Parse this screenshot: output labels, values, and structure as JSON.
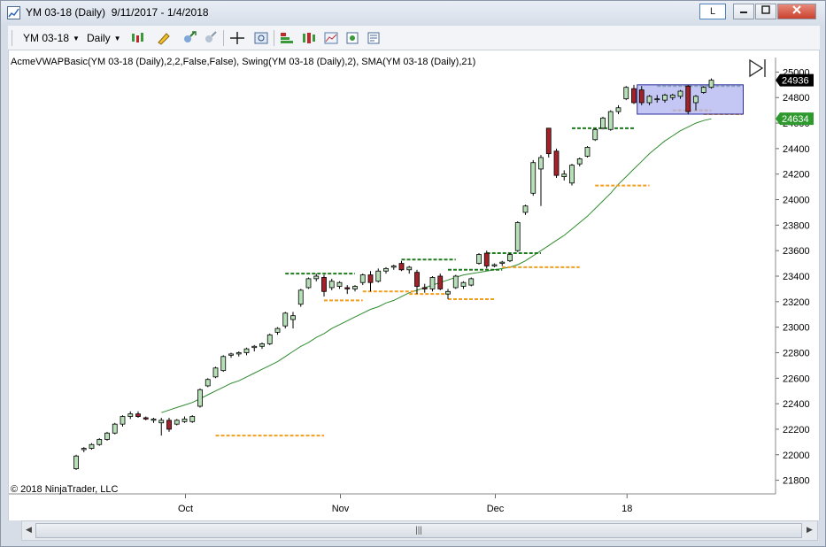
{
  "window": {
    "title": "YM 03-18 (Daily)  9/11/2017 - 1/4/2018",
    "link_button_label": "L",
    "icons": [
      "chart-window-icon",
      "minimize-icon",
      "maximize-icon",
      "close-icon"
    ]
  },
  "toolbar": {
    "instrument_label": "YM 03-18",
    "interval_label": "Daily",
    "icons": [
      "chart-style-icon",
      "drawing-tools-icon",
      "zoom-in-icon",
      "zoom-out-icon",
      "crosshair-icon",
      "data-box-icon",
      "indicators-icon",
      "strategies-icon",
      "templates-icon",
      "snapshot-icon",
      "properties-icon"
    ]
  },
  "chart": {
    "indicator_label": "AcmeVWAPBasic(YM 03-18 (Daily),2,2,False,False), Swing(YM 03-18 (Daily),2), SMA(YM 03-18 (Daily),21)",
    "copyright": "© 2018 NinjaTrader, LLC",
    "last_price_label": "24936",
    "sma_price_label": "24634",
    "colors": {
      "up_candle": "#b8e0b8",
      "down_candle": "#a3222a",
      "swing_high": "#1f7a1f",
      "swing_low": "#f0a020",
      "sma": "#2e8b2e",
      "price_badge": "#000000",
      "sma_badge": "#2e9a2e",
      "range_box": "#b0b3f0"
    }
  },
  "chart_data": {
    "type": "candlestick",
    "title": "YM 03-18 (Daily)",
    "x_tick_labels": [
      "Oct",
      "Nov",
      "Dec",
      "18"
    ],
    "y_tick_labels": [
      21800,
      22000,
      22200,
      22400,
      22600,
      22800,
      23000,
      23200,
      23400,
      23600,
      23800,
      24000,
      24200,
      24400,
      24600,
      24800,
      25000
    ],
    "ylim": [
      21700,
      25100
    ],
    "grid": false,
    "candles": [
      {
        "o": 21890,
        "h": 22000,
        "l": 21880,
        "c": 21990
      },
      {
        "o": 22040,
        "h": 22060,
        "l": 22020,
        "c": 22050
      },
      {
        "o": 22050,
        "h": 22090,
        "l": 22040,
        "c": 22080
      },
      {
        "o": 22080,
        "h": 22130,
        "l": 22070,
        "c": 22120
      },
      {
        "o": 22120,
        "h": 22180,
        "l": 22110,
        "c": 22170
      },
      {
        "o": 22170,
        "h": 22250,
        "l": 22160,
        "c": 22240
      },
      {
        "o": 22240,
        "h": 22310,
        "l": 22220,
        "c": 22300
      },
      {
        "o": 22300,
        "h": 22340,
        "l": 22280,
        "c": 22320
      },
      {
        "o": 22320,
        "h": 22340,
        "l": 22290,
        "c": 22300
      },
      {
        "o": 22290,
        "h": 22300,
        "l": 22270,
        "c": 22280
      },
      {
        "o": 22270,
        "h": 22290,
        "l": 22250,
        "c": 22280
      },
      {
        "o": 22250,
        "h": 22290,
        "l": 22150,
        "c": 22270
      },
      {
        "o": 22270,
        "h": 22290,
        "l": 22180,
        "c": 22200
      },
      {
        "o": 22240,
        "h": 22280,
        "l": 22230,
        "c": 22270
      },
      {
        "o": 22260,
        "h": 22300,
        "l": 22250,
        "c": 22280
      },
      {
        "o": 22260,
        "h": 22310,
        "l": 22250,
        "c": 22300
      },
      {
        "o": 22380,
        "h": 22520,
        "l": 22370,
        "c": 22510
      },
      {
        "o": 22540,
        "h": 22600,
        "l": 22530,
        "c": 22590
      },
      {
        "o": 22610,
        "h": 22690,
        "l": 22600,
        "c": 22680
      },
      {
        "o": 22660,
        "h": 22780,
        "l": 22650,
        "c": 22770
      },
      {
        "o": 22780,
        "h": 22800,
        "l": 22760,
        "c": 22790
      },
      {
        "o": 22790,
        "h": 22810,
        "l": 22770,
        "c": 22800
      },
      {
        "o": 22800,
        "h": 22840,
        "l": 22780,
        "c": 22830
      },
      {
        "o": 22840,
        "h": 22860,
        "l": 22810,
        "c": 22850
      },
      {
        "o": 22850,
        "h": 22880,
        "l": 22830,
        "c": 22870
      },
      {
        "o": 22870,
        "h": 22950,
        "l": 22860,
        "c": 22940
      },
      {
        "o": 22960,
        "h": 23000,
        "l": 22940,
        "c": 22990
      },
      {
        "o": 23010,
        "h": 23120,
        "l": 22990,
        "c": 23110
      },
      {
        "o": 23060,
        "h": 23120,
        "l": 22990,
        "c": 23090
      },
      {
        "o": 23180,
        "h": 23300,
        "l": 23160,
        "c": 23290
      },
      {
        "o": 23310,
        "h": 23390,
        "l": 23300,
        "c": 23380
      },
      {
        "o": 23380,
        "h": 23420,
        "l": 23360,
        "c": 23400
      },
      {
        "o": 23390,
        "h": 23410,
        "l": 23240,
        "c": 23280
      },
      {
        "o": 23310,
        "h": 23380,
        "l": 23290,
        "c": 23360
      },
      {
        "o": 23320,
        "h": 23360,
        "l": 23300,
        "c": 23350
      },
      {
        "o": 23310,
        "h": 23330,
        "l": 23260,
        "c": 23300
      },
      {
        "o": 23300,
        "h": 23330,
        "l": 23280,
        "c": 23320
      },
      {
        "o": 23350,
        "h": 23420,
        "l": 23330,
        "c": 23410
      },
      {
        "o": 23410,
        "h": 23440,
        "l": 23280,
        "c": 23350
      },
      {
        "o": 23360,
        "h": 23460,
        "l": 23350,
        "c": 23440
      },
      {
        "o": 23440,
        "h": 23470,
        "l": 23420,
        "c": 23460
      },
      {
        "o": 23470,
        "h": 23490,
        "l": 23450,
        "c": 23480
      },
      {
        "o": 23500,
        "h": 23520,
        "l": 23440,
        "c": 23450
      },
      {
        "o": 23450,
        "h": 23480,
        "l": 23420,
        "c": 23470
      },
      {
        "o": 23430,
        "h": 23450,
        "l": 23260,
        "c": 23320
      },
      {
        "o": 23310,
        "h": 23340,
        "l": 23270,
        "c": 23300
      },
      {
        "o": 23300,
        "h": 23400,
        "l": 23280,
        "c": 23390
      },
      {
        "o": 23400,
        "h": 23420,
        "l": 23290,
        "c": 23300
      },
      {
        "o": 23260,
        "h": 23300,
        "l": 23220,
        "c": 23280
      },
      {
        "o": 23310,
        "h": 23410,
        "l": 23300,
        "c": 23400
      },
      {
        "o": 23320,
        "h": 23360,
        "l": 23300,
        "c": 23350
      },
      {
        "o": 23330,
        "h": 23390,
        "l": 23320,
        "c": 23380
      },
      {
        "o": 23500,
        "h": 23580,
        "l": 23490,
        "c": 23570
      },
      {
        "o": 23580,
        "h": 23600,
        "l": 23460,
        "c": 23480
      },
      {
        "o": 23480,
        "h": 23500,
        "l": 23470,
        "c": 23490
      },
      {
        "o": 23500,
        "h": 23520,
        "l": 23480,
        "c": 23510
      },
      {
        "o": 23520,
        "h": 23580,
        "l": 23510,
        "c": 23570
      },
      {
        "o": 23600,
        "h": 23830,
        "l": 23590,
        "c": 23820
      },
      {
        "o": 23900,
        "h": 23960,
        "l": 23880,
        "c": 23950
      },
      {
        "o": 24050,
        "h": 24310,
        "l": 24030,
        "c": 24290
      },
      {
        "o": 24240,
        "h": 24350,
        "l": 23950,
        "c": 24330
      },
      {
        "o": 24560,
        "h": 24560,
        "l": 24330,
        "c": 24360
      },
      {
        "o": 24380,
        "h": 24400,
        "l": 24170,
        "c": 24190
      },
      {
        "o": 24180,
        "h": 24230,
        "l": 24150,
        "c": 24200
      },
      {
        "o": 24130,
        "h": 24280,
        "l": 24110,
        "c": 24270
      },
      {
        "o": 24280,
        "h": 24330,
        "l": 24260,
        "c": 24320
      },
      {
        "o": 24340,
        "h": 24420,
        "l": 24330,
        "c": 24410
      },
      {
        "o": 24470,
        "h": 24560,
        "l": 24460,
        "c": 24550
      },
      {
        "o": 24560,
        "h": 24650,
        "l": 24550,
        "c": 24640
      },
      {
        "o": 24550,
        "h": 24700,
        "l": 24540,
        "c": 24690
      },
      {
        "o": 24690,
        "h": 24740,
        "l": 24670,
        "c": 24720
      },
      {
        "o": 24790,
        "h": 24890,
        "l": 24780,
        "c": 24880
      },
      {
        "o": 24870,
        "h": 24900,
        "l": 24750,
        "c": 24760
      },
      {
        "o": 24860,
        "h": 24890,
        "l": 24740,
        "c": 24760
      },
      {
        "o": 24760,
        "h": 24820,
        "l": 24740,
        "c": 24810
      },
      {
        "o": 24790,
        "h": 24820,
        "l": 24760,
        "c": 24790
      },
      {
        "o": 24780,
        "h": 24830,
        "l": 24760,
        "c": 24820
      },
      {
        "o": 24800,
        "h": 24830,
        "l": 24780,
        "c": 24820
      },
      {
        "o": 24810,
        "h": 24860,
        "l": 24790,
        "c": 24850
      },
      {
        "o": 24890,
        "h": 24900,
        "l": 24670,
        "c": 24690
      },
      {
        "o": 24760,
        "h": 24820,
        "l": 24700,
        "c": 24810
      },
      {
        "o": 24840,
        "h": 24890,
        "l": 24830,
        "c": 24880
      },
      {
        "o": 24880,
        "h": 24950,
        "l": 24870,
        "c": 24936
      }
    ],
    "swing_highs": [
      {
        "from": 27,
        "to": 36,
        "value": 23420
      },
      {
        "from": 42,
        "to": 49,
        "value": 23530
      },
      {
        "from": 48,
        "to": 55,
        "value": 23450
      },
      {
        "from": 53,
        "to": 60,
        "value": 23580
      },
      {
        "from": 64,
        "to": 72,
        "value": 24560
      },
      {
        "from": 75,
        "to": 86,
        "value": 24890
      }
    ],
    "swing_lows": [
      {
        "from": 18,
        "to": 32,
        "value": 22150
      },
      {
        "from": 32,
        "to": 37,
        "value": 23210
      },
      {
        "from": 37,
        "to": 44,
        "value": 23280
      },
      {
        "from": 43,
        "to": 48,
        "value": 23260
      },
      {
        "from": 48,
        "to": 54,
        "value": 23220
      },
      {
        "from": 55,
        "to": 65,
        "value": 23470
      },
      {
        "from": 67,
        "to": 74,
        "value": 24110
      },
      {
        "from": 77,
        "to": 82,
        "value": 24700
      },
      {
        "from": 81,
        "to": 86,
        "value": 24670
      }
    ],
    "sma_21": [
      22330,
      22350,
      22370,
      22390,
      22410,
      22440,
      22470,
      22500,
      22530,
      22560,
      22580,
      22610,
      22640,
      22670,
      22700,
      22730,
      22770,
      22810,
      22850,
      22880,
      22920,
      22950,
      22990,
      23020,
      23050,
      23080,
      23110,
      23140,
      23160,
      23190,
      23210,
      23240,
      23270,
      23290,
      23310,
      23330,
      23350,
      23370,
      23390,
      23410,
      23420,
      23430,
      23440,
      23450,
      23460,
      23470,
      23490,
      23520,
      23560,
      23600,
      23640,
      23680,
      23720,
      23770,
      23820,
      23870,
      23930,
      23990,
      24050,
      24120,
      24180,
      24240,
      24300,
      24360,
      24410,
      24460,
      24500,
      24540,
      24570,
      24600,
      24620,
      24634
    ],
    "range_box": {
      "from_candle": 73,
      "to_candle": 86,
      "high": 24900,
      "low": 24670
    }
  }
}
